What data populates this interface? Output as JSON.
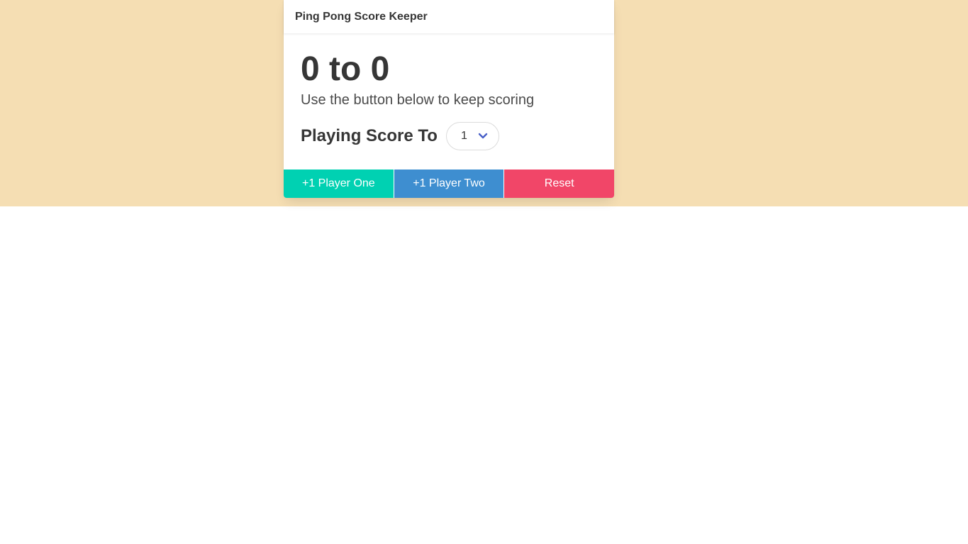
{
  "header": {
    "title": "Ping Pong Score Keeper"
  },
  "score": {
    "text": "0 to 0"
  },
  "subtitle": "Use the button below to keep scoring",
  "playing": {
    "label": "Playing Score To",
    "selected": "1"
  },
  "buttons": {
    "player_one": "+1 Player One",
    "player_two": "+1 Player Two",
    "reset": "Reset"
  },
  "colors": {
    "background": "#f5deb3",
    "player_one": "#00d1b2",
    "player_two": "#3e8ed0",
    "reset": "#f14668",
    "chevron": "#485fc7"
  },
  "icons": {
    "select_arrow": "chevron-down-icon"
  }
}
